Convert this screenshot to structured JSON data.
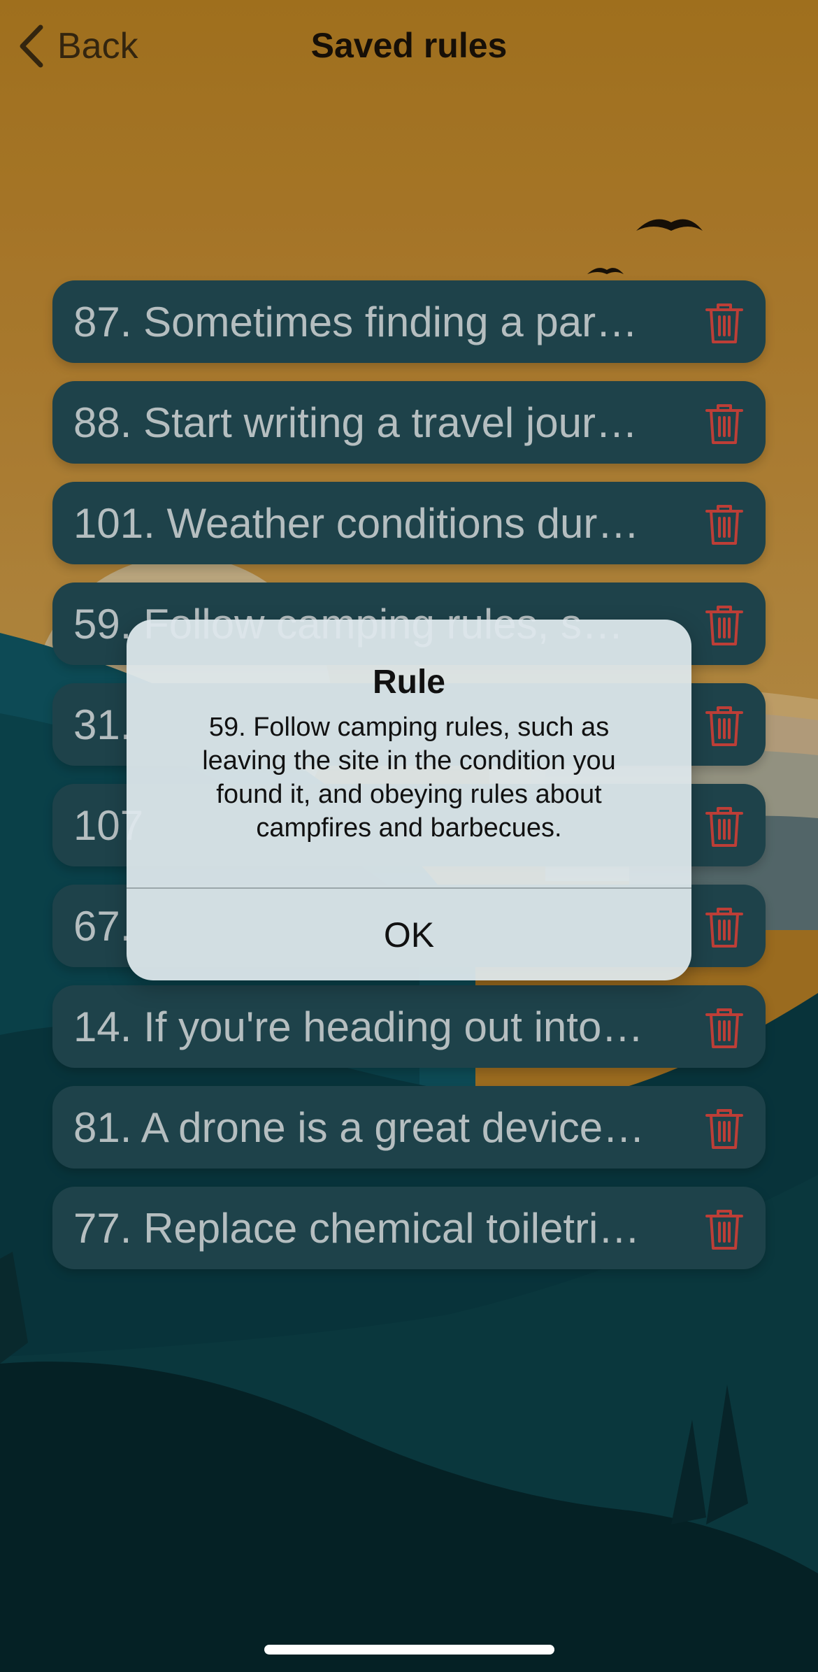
{
  "nav": {
    "back_label": "Back",
    "title": "Saved rules"
  },
  "rules": [
    {
      "text": "87. Sometimes finding a par…"
    },
    {
      "text": "88. Start writing a travel jour…"
    },
    {
      "text": "101. Weather conditions dur…"
    },
    {
      "text": "59. Follow camping rules, s…"
    },
    {
      "text": "31."
    },
    {
      "text": "107"
    },
    {
      "text": "67."
    },
    {
      "text": "14. If you're heading out into…"
    },
    {
      "text": "81. A drone is a great device…"
    },
    {
      "text": "77. Replace chemical toiletri…"
    }
  ],
  "dialog": {
    "title": "Rule",
    "message": "59. Follow camping rules, such as leaving the site in the condition you found it, and obeying rules about campfires and barbecues.",
    "ok_label": "OK"
  },
  "colors": {
    "sky": "#b07a24",
    "row_background": "#234c55",
    "row_text": "#cfd9db",
    "delete_icon": "#d8473f",
    "dialog_background": "#dee8ec"
  }
}
